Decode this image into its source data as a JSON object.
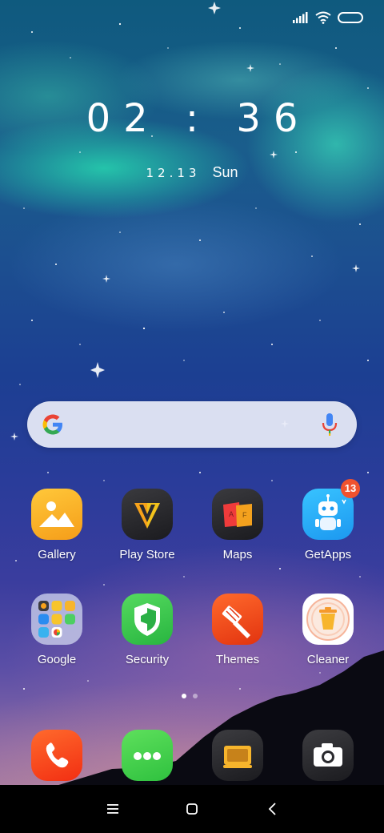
{
  "status_bar": {
    "icons": [
      "signal-icon",
      "wifi-icon",
      "battery-icon"
    ]
  },
  "clock": {
    "time": "02 : 36",
    "date": "12.13",
    "day": "Sun"
  },
  "search": {
    "logo": "google-g-icon",
    "mic_icon": "microphone-icon"
  },
  "apps": [
    {
      "label": "Gallery",
      "icon": "gallery-icon"
    },
    {
      "label": "Play Store",
      "icon": "play-store-icon"
    },
    {
      "label": "Maps",
      "icon": "maps-icon"
    },
    {
      "label": "GetApps",
      "icon": "getapps-icon",
      "badge": "13"
    },
    {
      "label": "Google",
      "icon": "google-folder-icon"
    },
    {
      "label": "Security",
      "icon": "security-icon"
    },
    {
      "label": "Themes",
      "icon": "themes-icon"
    },
    {
      "label": "Cleaner",
      "icon": "cleaner-icon"
    }
  ],
  "page_indicator": {
    "pages": 2,
    "active": 1
  },
  "dock": [
    {
      "icon": "phone-icon"
    },
    {
      "icon": "messages-icon"
    },
    {
      "icon": "screen-recorder-icon"
    },
    {
      "icon": "camera-icon"
    }
  ],
  "nav_bar": {
    "buttons": [
      "menu-icon",
      "home-icon",
      "back-icon"
    ]
  },
  "colors": {
    "badge": "#f0522e",
    "gallery": "#f7b52c",
    "security": "#3fca4f",
    "themes": "#ef4a1e",
    "phone": "#ff4a1a",
    "messages": "#3cd14a"
  }
}
